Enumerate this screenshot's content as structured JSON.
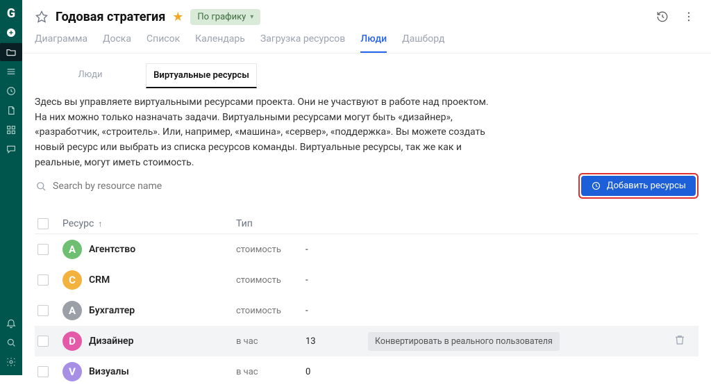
{
  "project": {
    "title": "Годовая стратегия",
    "status_label": "По графику"
  },
  "tabs_primary": [
    {
      "label": "Диаграмма"
    },
    {
      "label": "Доска"
    },
    {
      "label": "Список"
    },
    {
      "label": "Календарь"
    },
    {
      "label": "Загрузка ресурсов"
    },
    {
      "label": "Люди"
    },
    {
      "label": "Дашборд"
    }
  ],
  "tabs_secondary": [
    {
      "label": "Люди"
    },
    {
      "label": "Виртуальные ресурсы"
    }
  ],
  "description": "Здесь вы управляете виртуальными ресурсами проекта. Они не участвуют в работе над проектом. На них можно только назначать задачи. Виртуальными ресурсами могут быть «дизайнер», «разработчик, «строитель». Или, например, «машина», «сервер», «поддержка». Вы можете создать новый ресурс или выбрать из списка ресурсов команды. Виртуальные ресурсы, так же как и реальные, могут иметь стоимость.",
  "search": {
    "placeholder": "Search by resource name"
  },
  "add_button_label": "Добавить ресурсы",
  "table": {
    "header_resource": "Ресурс",
    "header_type": "Тип",
    "rows": [
      {
        "letter": "А",
        "name": "Агентство",
        "type": "стоимость",
        "value": "-",
        "color": "av-green"
      },
      {
        "letter": "C",
        "name": "CRM",
        "type": "стоимость",
        "value": "-",
        "color": "av-yellow"
      },
      {
        "letter": "А",
        "name": "Бухгалтер",
        "type": "стоимость",
        "value": "-",
        "color": "av-grey"
      },
      {
        "letter": "D",
        "name": "Дизайнер",
        "type": "в час",
        "value": "13",
        "color": "av-pink",
        "hovered": true
      },
      {
        "letter": "V",
        "name": "Визуалы",
        "type": "в час",
        "value": "0",
        "color": "av-violet"
      }
    ]
  },
  "convert_label": "Конвертировать в реального пользователя"
}
